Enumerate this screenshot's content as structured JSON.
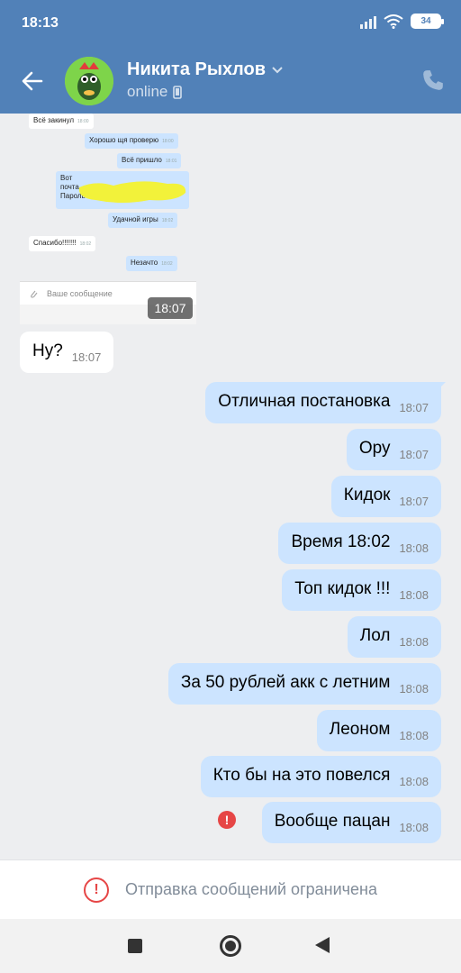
{
  "status_bar": {
    "time": "18:13",
    "battery": "34"
  },
  "header": {
    "contact_name": "Никита Рыхлов",
    "status": "online"
  },
  "screenshot": {
    "messages": [
      {
        "text": "Всё закинул",
        "time": "18:00"
      },
      {
        "text": "Хорошо щя проверю",
        "time": "18:00"
      },
      {
        "text": "Всё пришло",
        "time": "18:01"
      },
      {
        "text": "Вот",
        "time": ""
      },
      {
        "text": "почта",
        "time": ""
      },
      {
        "text": "Пароль",
        "time": ""
      },
      {
        "text": "Удачной игры",
        "time": "18:02"
      },
      {
        "text": "Спасибо!!!!!!!",
        "time": "18:02"
      },
      {
        "text": "Незачто",
        "time": "18:02"
      }
    ],
    "input_placeholder": "Ваше сообщение",
    "badge_time": "18:07"
  },
  "messages": [
    {
      "text": "Ну?",
      "time": "18:07"
    },
    {
      "text": "Отличная постановка",
      "time": "18:07"
    },
    {
      "text": "Ору",
      "time": "18:07"
    },
    {
      "text": "Кидок",
      "time": "18:07"
    },
    {
      "text": "Время 18:02",
      "time": "18:08"
    },
    {
      "text": "Топ кидок !!!",
      "time": "18:08"
    },
    {
      "text": "Лол",
      "time": "18:08"
    },
    {
      "text": "За 50 рублей акк с летним",
      "time": "18:08"
    },
    {
      "text": "Леоном",
      "time": "18:08"
    },
    {
      "text": "Кто бы на это повелся",
      "time": "18:08"
    },
    {
      "text": "Вообще пацан",
      "time": "18:08"
    }
  ],
  "restriction": {
    "text": "Отправка сообщений ограничена"
  },
  "colors": {
    "header": "#5181b8",
    "outgoing_bubble": "#cce4ff",
    "error": "#e64646"
  }
}
